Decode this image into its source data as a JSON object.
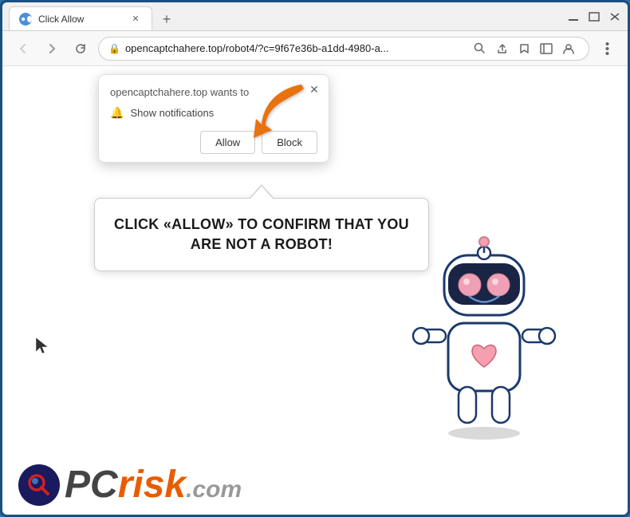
{
  "window": {
    "title": "Click Allow",
    "favicon_label": "site-favicon"
  },
  "titlebar": {
    "tab_label": "Click Allow",
    "new_tab_label": "+",
    "minimize_label": "—",
    "maximize_label": "❑",
    "close_label": "✕",
    "restore_label": "⧉"
  },
  "addressbar": {
    "back_label": "←",
    "forward_label": "→",
    "refresh_label": "↻",
    "url": "opencaptchahere.top/robot4/?c=9f67e36b-a1dd-4980-a...",
    "lock_icon": "🔒",
    "search_icon": "🔍",
    "share_icon": "⎙",
    "star_icon": "☆",
    "sidebar_icon": "▭",
    "profile_icon": "👤",
    "menu_icon": "⋮"
  },
  "notification_popup": {
    "title": "opencaptchahere.top wants to",
    "notification_label": "Show notifications",
    "allow_button": "Allow",
    "block_button": "Block",
    "close_icon": "✕"
  },
  "speech_bubble": {
    "text_line1": "CLICK «ALLOW» TO CONFIRM THAT YOU",
    "text_line2": "ARE NOT A ROBOT!"
  },
  "pcrisk": {
    "pc_text": "PC",
    "risk_text": "risk",
    "dotcom_text": ".com"
  },
  "colors": {
    "orange_arrow": "#e8720c",
    "allow_button_bg": "#ffffff",
    "bubble_border": "#cccccc",
    "window_border": "#2d6fa3",
    "pcrisk_pc": "#444444",
    "pcrisk_risk": "#e85c00"
  }
}
